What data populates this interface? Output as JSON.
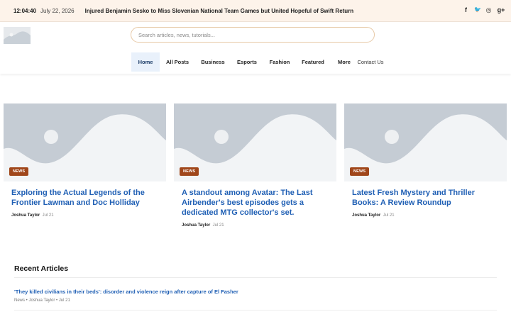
{
  "topbar": {
    "clock": "12:04:40",
    "date": "July 22, 2026",
    "ticker": "Injured Benjamin Sesko to Miss Slovenian National Team Games but United Hopeful of Swift Return",
    "social": [
      {
        "icon": "facebook-icon",
        "glyph": "f"
      },
      {
        "icon": "twitter-icon",
        "glyph": "🐦"
      },
      {
        "icon": "instagram-icon",
        "glyph": "◎"
      },
      {
        "icon": "google-plus-icon",
        "glyph": "g+"
      }
    ]
  },
  "search": {
    "placeholder": "Search articles, news, tutorials..."
  },
  "nav": {
    "items": [
      "Home",
      "All Posts",
      "Business",
      "Esports",
      "Fashion",
      "Featured",
      "More"
    ],
    "contact": "Contact Us"
  },
  "cards": [
    {
      "badge": "NEWS",
      "title": "Exploring the Actual Legends of the Frontier Lawman and Doc Holliday",
      "author": "Joshua Taylor",
      "date": "Jul 21"
    },
    {
      "badge": "NEWS",
      "title": "A standout among Avatar: The Last Airbender's best episodes gets a dedicated MTG collector's set.",
      "author": "Joshua Taylor",
      "date": "Jul 21"
    },
    {
      "badge": "NEWS",
      "title": "Latest Fresh Mystery and Thriller Books: A Review Roundup",
      "author": "Joshua Taylor",
      "date": "Jul 21"
    }
  ],
  "recent": {
    "heading": "Recent Articles",
    "items": [
      {
        "title": "'They killed civilians in their beds': disorder and violence reign after capture of El Fasher",
        "meta": "News • Joshua Taylor • Jul 21"
      }
    ]
  }
}
